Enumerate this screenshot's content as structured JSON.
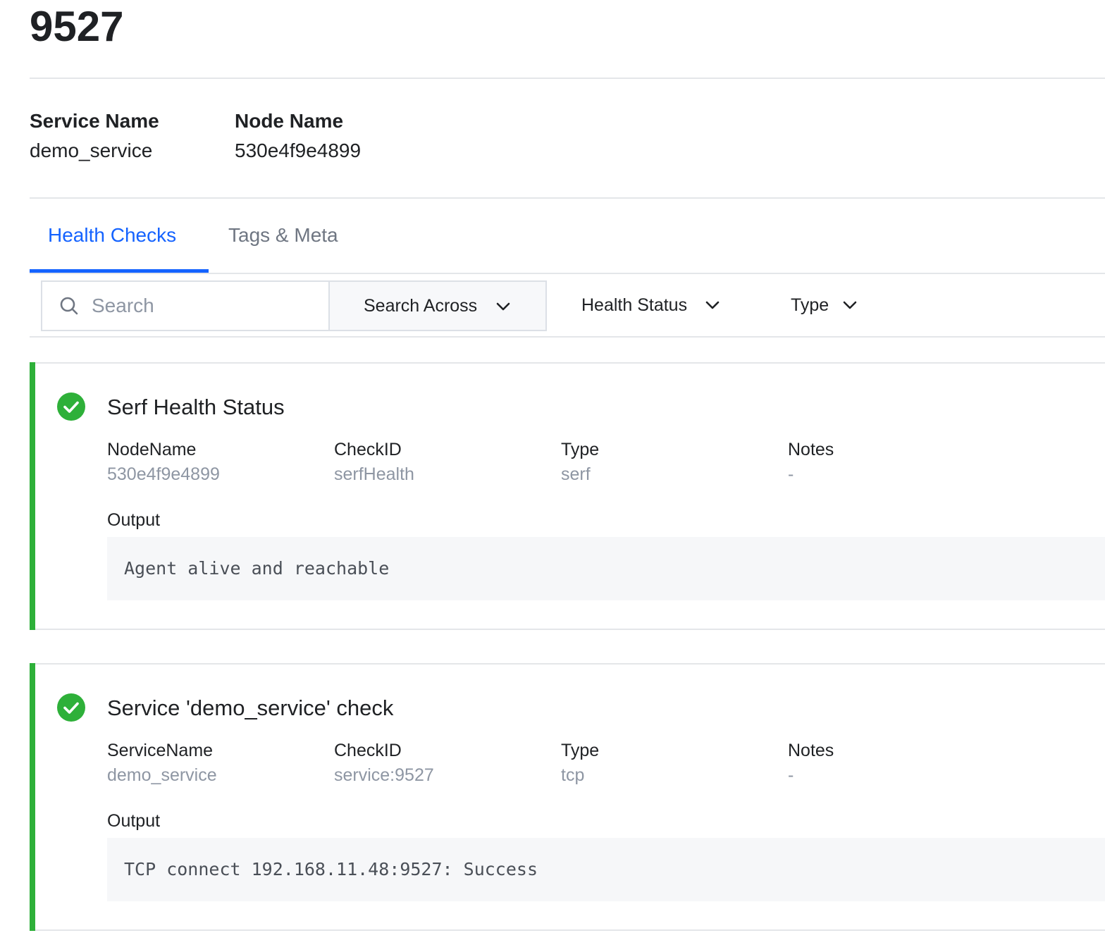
{
  "page": {
    "title": "9527"
  },
  "details": {
    "service_name_label": "Service Name",
    "service_name_value": "demo_service",
    "node_name_label": "Node Name",
    "node_name_value": "530e4f9e4899"
  },
  "tabs": [
    {
      "label": "Health Checks",
      "active": true
    },
    {
      "label": "Tags & Meta",
      "active": false
    }
  ],
  "toolbar": {
    "search_placeholder": "Search",
    "search_value": "",
    "search_across_label": "Search Across",
    "health_status_label": "Health Status",
    "type_label": "Type"
  },
  "checks": [
    {
      "title": "Serf Health Status",
      "status": "passing",
      "fields": [
        {
          "label": "NodeName",
          "value": "530e4f9e4899"
        },
        {
          "label": "CheckID",
          "value": "serfHealth"
        },
        {
          "label": "Type",
          "value": "serf"
        },
        {
          "label": "Notes",
          "value": "-"
        }
      ],
      "output_label": "Output",
      "output": "Agent alive and reachable"
    },
    {
      "title": "Service 'demo_service' check",
      "status": "passing",
      "fields": [
        {
          "label": "ServiceName",
          "value": "demo_service"
        },
        {
          "label": "CheckID",
          "value": "service:9527"
        },
        {
          "label": "Type",
          "value": "tcp"
        },
        {
          "label": "Notes",
          "value": "-"
        }
      ],
      "output_label": "Output",
      "output": "TCP connect 192.168.11.48:9527: Success"
    }
  ],
  "colors": {
    "accent": "#1563ff",
    "passing": "#2eb039",
    "muted": "#8e96a3",
    "border": "#e4e6e9"
  }
}
